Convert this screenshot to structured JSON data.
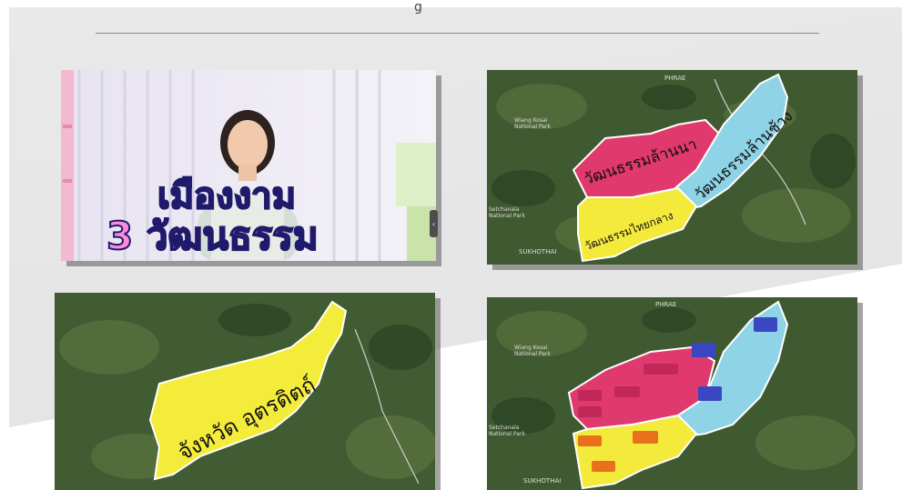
{
  "header": {
    "glyph": "g"
  },
  "video": {
    "line1": "เมืองงาม",
    "line2": "3 วัฒนธรรม"
  },
  "map_culture": {
    "pink_label": "วัฒนธรรมล้านนา",
    "blue_label": "วัฒนธรรมล้านช้าง",
    "yellow_label": "วัฒนธรรมไทยกลาง",
    "places": [
      "PHRAE",
      "Wiang Kosai National Park",
      "Setchanala National Park",
      "SUKHOTHAI"
    ]
  },
  "map_province": {
    "label": "จังหวัด อุตรดิตถ์"
  },
  "map_districts": {
    "places": [
      "PHRAE",
      "Wiang Kosai National Park",
      "Setchanala National Park",
      "SUKHOTHAI"
    ]
  },
  "colors": {
    "pink": "#e0396d",
    "blue": "#8fd3e6",
    "yellow": "#f3ea3c",
    "map_green": "#3f5a31"
  }
}
